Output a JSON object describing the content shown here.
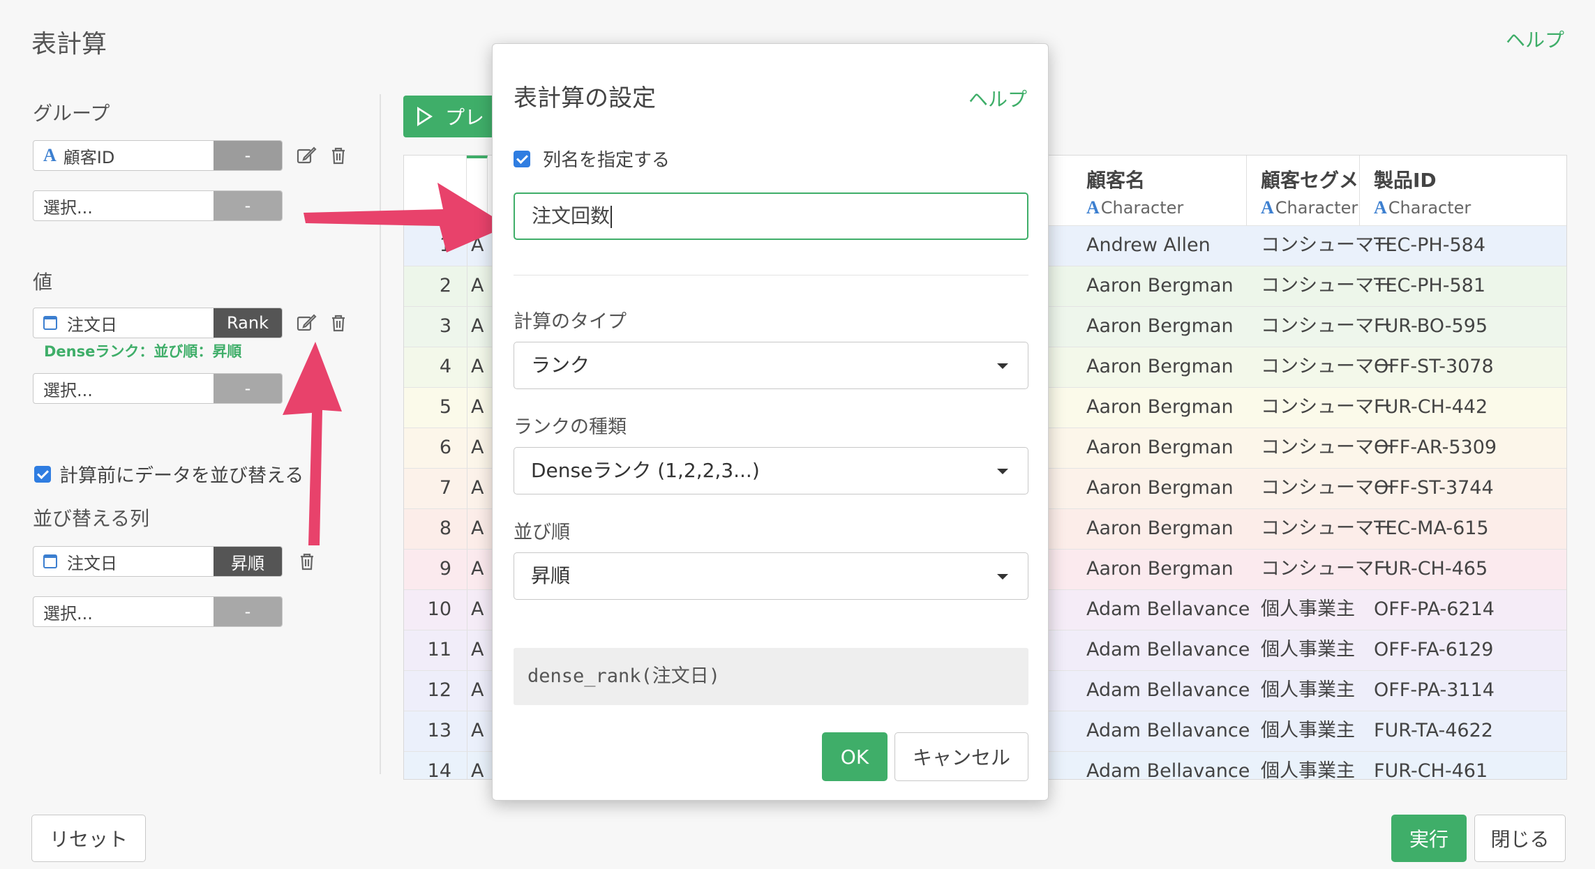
{
  "background_dialog": {
    "title": "表計算",
    "help": "ヘルプ",
    "group_label": "グループ",
    "group_fields": [
      {
        "name": "顧客ID",
        "tag": "-",
        "type_icon": "character-a-icon"
      },
      {
        "name": "選択...",
        "tag": "-"
      }
    ],
    "value_label": "値",
    "value_fields": [
      {
        "name": "注文日",
        "tag": "Rank",
        "type_icon": "calendar-icon"
      },
      {
        "name": "選択...",
        "tag": "-"
      }
    ],
    "value_note": "Denseランク：並び順：昇順",
    "sort_checkbox_label": "計算前にデータを並び替える",
    "sort_checked": true,
    "sort_label": "並び替える列",
    "sort_fields": [
      {
        "name": "注文日",
        "tag": "昇順",
        "type_icon": "calendar-icon"
      },
      {
        "name": "選択...",
        "tag": "-"
      }
    ],
    "preview_button": "プレ",
    "reset_button": "リセット",
    "run_button": "実行",
    "close_button": "閉じる"
  },
  "table": {
    "columns": [
      {
        "name": "顧客名",
        "type": "Character"
      },
      {
        "name": "顧客セグメント",
        "type": "Character"
      },
      {
        "name": "製品ID",
        "type": "Character"
      }
    ],
    "partial_column_letter": "A",
    "rows": [
      {
        "n": "1",
        "name": "Andrew Allen",
        "segment": "コンシューマー",
        "product": "TEC-PH-584",
        "color": "#eaf1fb"
      },
      {
        "n": "2",
        "name": "Aaron Bergman",
        "segment": "コンシューマー",
        "product": "TEC-PH-581",
        "color": "#edf6ea"
      },
      {
        "n": "3",
        "name": "Aaron Bergman",
        "segment": "コンシューマー",
        "product": "FUR-BO-595",
        "color": "#eef6ec"
      },
      {
        "n": "4",
        "name": "Aaron Bergman",
        "segment": "コンシューマー",
        "product": "OFF-ST-3078",
        "color": "#f3f8ea"
      },
      {
        "n": "5",
        "name": "Aaron Bergman",
        "segment": "コンシューマー",
        "product": "FUR-CH-442",
        "color": "#fbfaea"
      },
      {
        "n": "6",
        "name": "Aaron Bergman",
        "segment": "コンシューマー",
        "product": "OFF-AR-5309",
        "color": "#fcf6ea"
      },
      {
        "n": "7",
        "name": "Aaron Bergman",
        "segment": "コンシューマー",
        "product": "OFF-ST-3744",
        "color": "#fcf2ea"
      },
      {
        "n": "8",
        "name": "Aaron Bergman",
        "segment": "コンシューマー",
        "product": "TEC-MA-615",
        "color": "#fcede9"
      },
      {
        "n": "9",
        "name": "Aaron Bergman",
        "segment": "コンシューマー",
        "product": "FUR-CH-465",
        "color": "#fbeaee"
      },
      {
        "n": "10",
        "name": "Adam Bellavance",
        "segment": "個人事業主",
        "product": "OFF-PA-6214",
        "color": "#f5ecf7"
      },
      {
        "n": "11",
        "name": "Adam Bellavance",
        "segment": "個人事業主",
        "product": "OFF-FA-6129",
        "color": "#f1edf9"
      },
      {
        "n": "12",
        "name": "Adam Bellavance",
        "segment": "個人事業主",
        "product": "OFF-PA-3114",
        "color": "#eeeefa"
      },
      {
        "n": "13",
        "name": "Adam Bellavance",
        "segment": "個人事業主",
        "product": "FUR-TA-4622",
        "color": "#ebf0fb"
      },
      {
        "n": "14",
        "name": "Adam Bellavance",
        "segment": "個人事業主",
        "product": "FUR-CH-461",
        "color": "#eaf2fb"
      }
    ]
  },
  "modal": {
    "title": "表計算の設定",
    "help": "ヘルプ",
    "specify_name_label": "列名を指定する",
    "specify_name_checked": true,
    "column_name_value": "注文回数",
    "calc_type_label": "計算のタイプ",
    "calc_type_value": "ランク",
    "rank_kind_label": "ランクの種類",
    "rank_kind_value": "Denseランク (1,2,2,3...)",
    "sort_order_label": "並び順",
    "sort_order_value": "昇順",
    "formula": "dense_rank(注文日)",
    "ok_button": "OK",
    "cancel_button": "キャンセル"
  },
  "colors": {
    "accent_green": "#3fae69",
    "arrow_pink": "#e8426b",
    "type_blue": "#3c7fd0"
  }
}
